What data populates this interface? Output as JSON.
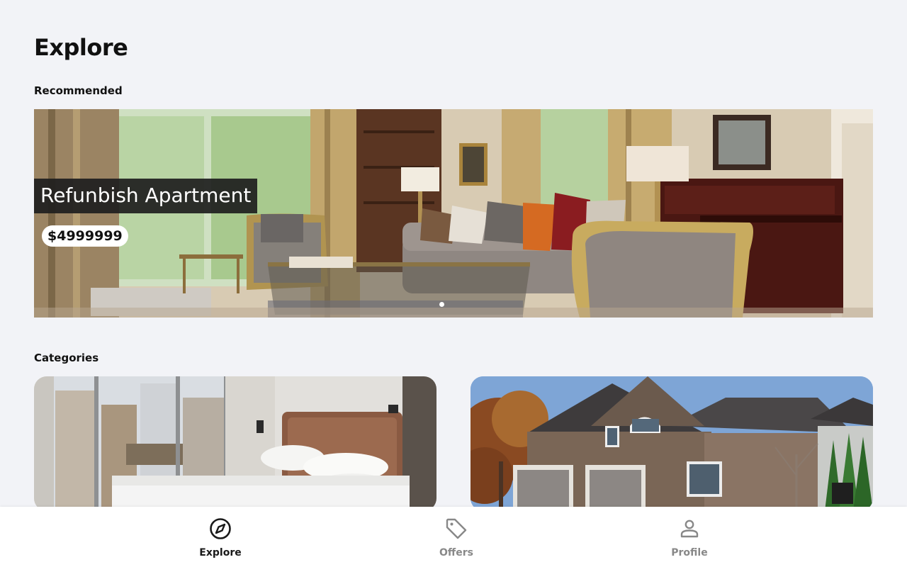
{
  "header": {
    "title": "Explore"
  },
  "sections": {
    "recommended": "Recommended",
    "categories": "Categories"
  },
  "recommended": {
    "title": "Refunbish Apartment",
    "price": "$4999999",
    "slide_count": 1,
    "active_slide": 1
  },
  "categories": [
    {
      "image": "bedroom-photo"
    },
    {
      "image": "house-exterior-photo"
    }
  ],
  "nav": {
    "items": [
      {
        "label": "Explore",
        "icon": "compass-icon",
        "active": true
      },
      {
        "label": "Offers",
        "icon": "tag-icon",
        "active": false
      },
      {
        "label": "Profile",
        "icon": "user-icon",
        "active": false
      }
    ],
    "active_color": "#1a1a1a",
    "inactive_color": "#888888"
  }
}
